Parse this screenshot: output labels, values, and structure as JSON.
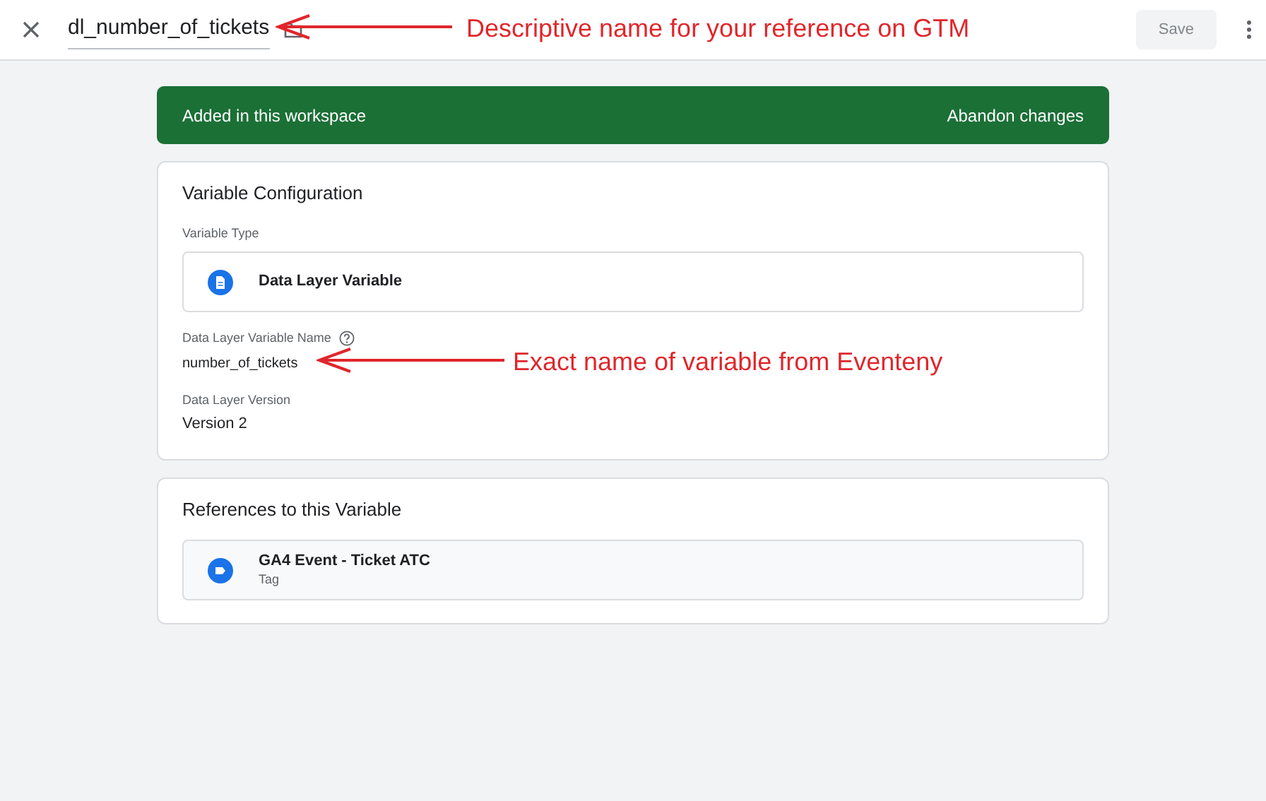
{
  "header": {
    "title": "dl_number_of_tickets",
    "save_label": "Save",
    "save_disabled": true
  },
  "banner": {
    "message": "Added in this workspace",
    "action": "Abandon changes"
  },
  "configuration": {
    "heading": "Variable Configuration",
    "type_label": "Variable Type",
    "type_value": "Data Layer Variable",
    "fields": [
      {
        "label": "Data Layer Variable Name",
        "help": true,
        "value": "number_of_tickets"
      },
      {
        "label": "Data Layer Version",
        "help": false,
        "value": "Version 2"
      }
    ]
  },
  "references": {
    "heading": "References to this Variable",
    "items": [
      {
        "name": "GA4 Event - Ticket ATC",
        "type": "Tag"
      }
    ]
  },
  "annotations": {
    "title_note": "Descriptive name for your reference on GTM",
    "field_note": "Exact name of variable from Eventeny"
  }
}
